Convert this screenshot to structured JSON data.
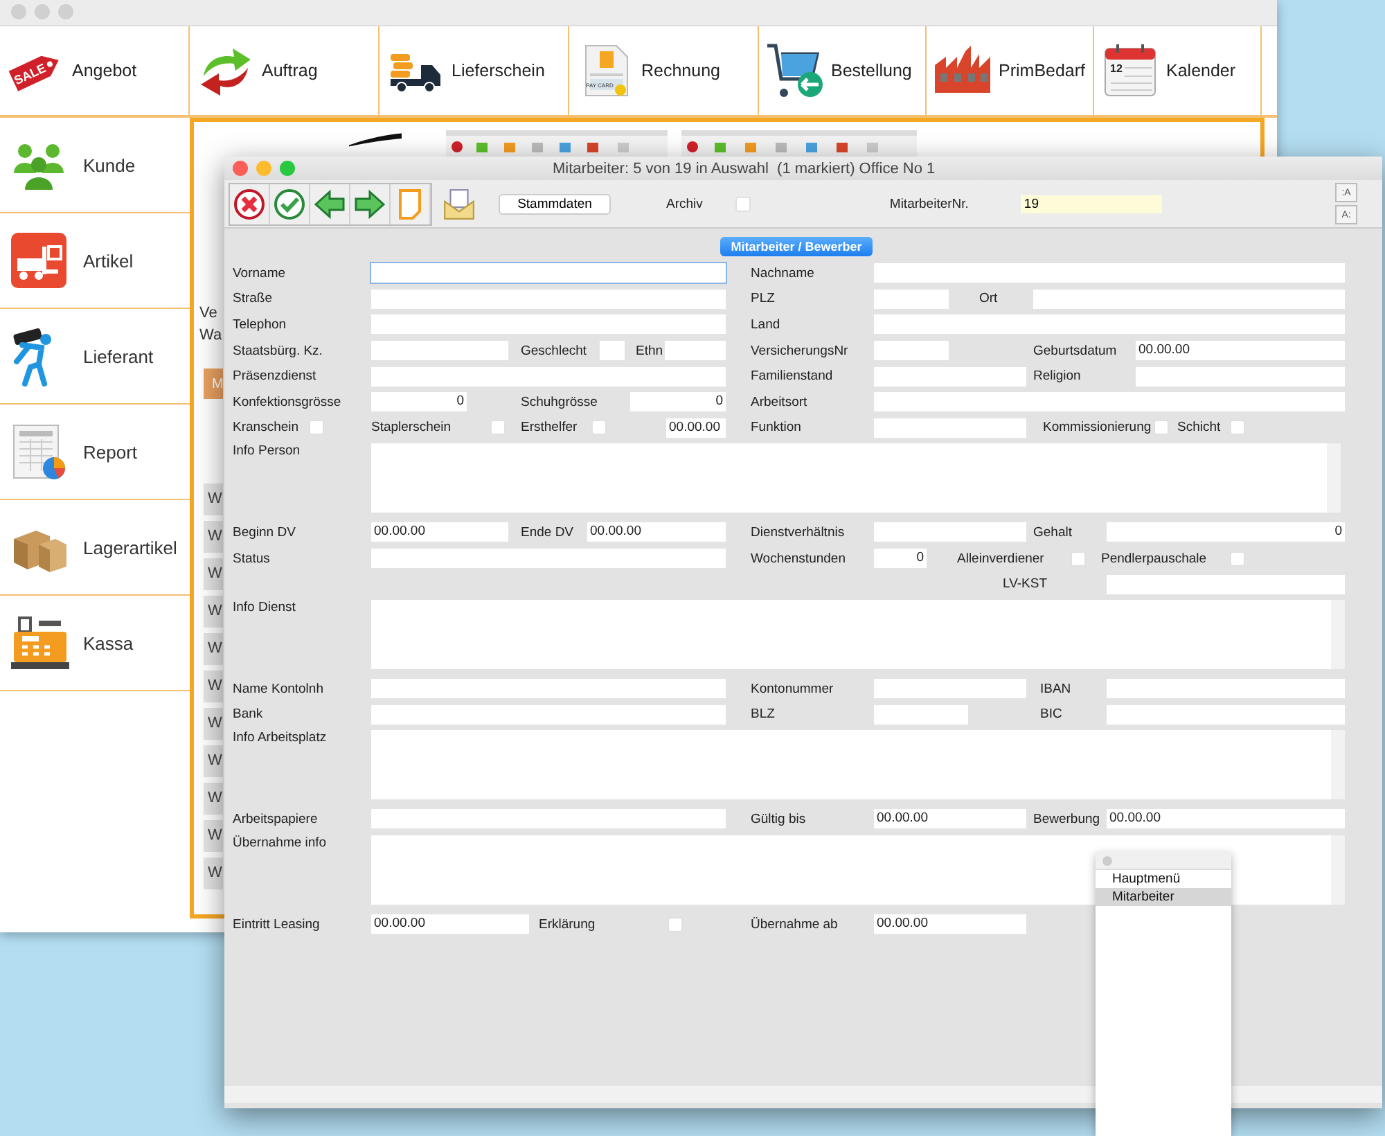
{
  "back_window": {
    "toolbar": [
      {
        "label": "Angebot",
        "badge": "SALE"
      },
      {
        "label": "Auftrag"
      },
      {
        "label": "Lieferschein"
      },
      {
        "label": "Rechnung",
        "badge": "PAY CARD"
      },
      {
        "label": "Bestellung"
      },
      {
        "label": "PrimBedarf"
      },
      {
        "label": "Kalender",
        "badge": "12"
      }
    ],
    "sidebar": [
      {
        "label": "Kunde"
      },
      {
        "label": "Artikel"
      },
      {
        "label": "Lieferant"
      },
      {
        "label": "Report"
      },
      {
        "label": "Lagerartikel"
      },
      {
        "label": "Kassa"
      }
    ],
    "content": {
      "texts": [
        "Ve",
        "Wa"
      ],
      "button": "M",
      "list_rows": [
        "W",
        "W",
        "W",
        "W",
        "W",
        "W",
        "W",
        "W",
        "W",
        "W",
        "W"
      ]
    }
  },
  "front_window": {
    "title": "Mitarbeiter: 5 von 19 in Auswahl  (1 markiert) Office No 1",
    "toolbar": {
      "button": "Stammdaten",
      "archiv_label": "Archiv",
      "archiv_checked": false,
      "nr_label": "MitarbeiterNr.",
      "nr_value": "19",
      "font_buttons": [
        ":A",
        "A:"
      ]
    },
    "tab": {
      "label": "Mitarbeiter / Bewerber",
      "selected": true
    },
    "form": [
      {
        "items": [
          {
            "kind": "label",
            "text": "Vorname"
          },
          {
            "kind": "field",
            "focused": true
          },
          {
            "kind": "label",
            "text": "Nachname"
          },
          {
            "kind": "field",
            "focused": false
          }
        ]
      },
      {
        "items": [
          {
            "kind": "label",
            "text": "Straße"
          },
          {
            "kind": "field",
            "focused": false
          },
          {
            "kind": "label",
            "text": "PLZ"
          },
          {
            "kind": "field",
            "focused": false
          },
          {
            "kind": "label",
            "text": "Ort"
          },
          {
            "kind": "field",
            "focused": false
          }
        ]
      },
      {
        "items": [
          {
            "kind": "label",
            "text": "Telephon"
          },
          {
            "kind": "field",
            "focused": false
          },
          {
            "kind": "label",
            "text": "Land"
          },
          {
            "kind": "field",
            "focused": false
          }
        ]
      },
      {
        "items": [
          {
            "kind": "label",
            "text": "Staatsbürg. Kz."
          },
          {
            "kind": "field",
            "focused": false
          },
          {
            "kind": "label",
            "text": "Geschlecht"
          },
          {
            "kind": "field",
            "focused": false
          },
          {
            "kind": "label",
            "text": "Ethn"
          },
          {
            "kind": "field",
            "focused": false
          },
          {
            "kind": "label",
            "text": "VersicherungsNr"
          },
          {
            "kind": "field",
            "focused": false
          },
          {
            "kind": "label",
            "text": "Geburtsdatum"
          },
          {
            "kind": "field",
            "value": "00.00.00",
            "focused": false
          }
        ]
      },
      {
        "items": [
          {
            "kind": "label",
            "text": "Präsenzdienst"
          },
          {
            "kind": "field",
            "focused": false
          },
          {
            "kind": "label",
            "text": "Familienstand"
          },
          {
            "kind": "field",
            "focused": false
          },
          {
            "kind": "label",
            "text": "Religion"
          },
          {
            "kind": "field",
            "focused": false
          }
        ]
      },
      {
        "items": [
          {
            "kind": "label",
            "text": "Konfektionsgrösse"
          },
          {
            "kind": "number",
            "value": "0",
            "focused": false
          },
          {
            "kind": "label",
            "text": "Schuhgrösse"
          },
          {
            "kind": "number",
            "value": "0",
            "focused": false
          },
          {
            "kind": "label",
            "text": "Arbeitsort"
          },
          {
            "kind": "field",
            "focused": false
          }
        ]
      },
      {
        "items": [
          {
            "kind": "label",
            "text": "Kranschein"
          },
          {
            "kind": "checkbox",
            "checked": false
          },
          {
            "kind": "label",
            "text": "Staplerschein"
          },
          {
            "kind": "checkbox",
            "checked": false
          },
          {
            "kind": "label",
            "text": "Ersthelfer"
          },
          {
            "kind": "checkbox",
            "checked": false
          },
          {
            "kind": "field",
            "value": "00.00.00",
            "focused": false
          },
          {
            "kind": "label",
            "text": "Funktion"
          },
          {
            "kind": "field",
            "focused": false
          },
          {
            "kind": "label",
            "text": "Kommissionierung"
          },
          {
            "kind": "checkbox",
            "checked": false
          },
          {
            "kind": "label",
            "text": "Schicht"
          },
          {
            "kind": "checkbox",
            "checked": false
          }
        ]
      },
      {
        "items": [
          {
            "kind": "label",
            "text": "Info Person"
          },
          {
            "kind": "memo"
          }
        ]
      },
      {
        "items": [
          {
            "kind": "label",
            "text": "Beginn DV"
          },
          {
            "kind": "field",
            "value": "00.00.00",
            "focused": false
          },
          {
            "kind": "label",
            "text": "Ende DV"
          },
          {
            "kind": "field",
            "value": "00.00.00",
            "focused": false
          },
          {
            "kind": "label",
            "text": "Dienstverhältnis"
          },
          {
            "kind": "field",
            "focused": false
          },
          {
            "kind": "label",
            "text": "Gehalt"
          },
          {
            "kind": "number",
            "value": "0",
            "focused": false
          }
        ]
      },
      {
        "items": [
          {
            "kind": "label",
            "text": "Status"
          },
          {
            "kind": "field",
            "focused": false
          },
          {
            "kind": "label",
            "text": "Wochenstunden"
          },
          {
            "kind": "number",
            "value": "0",
            "focused": false
          },
          {
            "kind": "label",
            "text": "Alleinverdiener"
          },
          {
            "kind": "checkbox",
            "checked": false
          },
          {
            "kind": "label",
            "text": "Pendlerpauschale"
          },
          {
            "kind": "checkbox",
            "checked": false
          }
        ]
      },
      {
        "items": [
          {
            "kind": "label",
            "text": "LV-KST"
          },
          {
            "kind": "field",
            "focused": false
          }
        ]
      },
      {
        "items": [
          {
            "kind": "label",
            "text": "Info Dienst"
          },
          {
            "kind": "memo"
          }
        ]
      },
      {
        "items": [
          {
            "kind": "label",
            "text": "Name Kontolnh"
          },
          {
            "kind": "field",
            "focused": false
          },
          {
            "kind": "label",
            "text": "Kontonummer"
          },
          {
            "kind": "field",
            "focused": false
          },
          {
            "kind": "label",
            "text": "IBAN"
          },
          {
            "kind": "field",
            "focused": false
          }
        ]
      },
      {
        "items": [
          {
            "kind": "label",
            "text": "Bank"
          },
          {
            "kind": "field",
            "focused": false
          },
          {
            "kind": "label",
            "text": "BLZ"
          },
          {
            "kind": "field",
            "focused": false
          },
          {
            "kind": "label",
            "text": "BIC"
          },
          {
            "kind": "field",
            "focused": false
          }
        ]
      },
      {
        "items": [
          {
            "kind": "label",
            "text": "Info Arbeitsplatz"
          },
          {
            "kind": "memo"
          }
        ]
      },
      {
        "items": [
          {
            "kind": "label",
            "text": "Arbeitspapiere"
          },
          {
            "kind": "field",
            "focused": false
          },
          {
            "kind": "label",
            "text": "Gültig bis"
          },
          {
            "kind": "field",
            "value": "00.00.00",
            "focused": false
          },
          {
            "kind": "label",
            "text": "Bewerbung"
          },
          {
            "kind": "field",
            "value": "00.00.00",
            "focused": false
          }
        ]
      },
      {
        "items": [
          {
            "kind": "label",
            "text": "Übernahme info"
          },
          {
            "kind": "memo"
          }
        ]
      },
      {
        "items": [
          {
            "kind": "label",
            "text": "Eintritt Leasing"
          },
          {
            "kind": "field",
            "value": "00.00.00",
            "focused": false
          },
          {
            "kind": "label",
            "text": "Erklärung"
          },
          {
            "kind": "checkbox",
            "checked": false
          },
          {
            "kind": "label",
            "text": "Übernahme ab"
          },
          {
            "kind": "field",
            "value": "00.00.00",
            "focused": false
          }
        ]
      }
    ]
  },
  "popup_menu": {
    "items": [
      {
        "label": "Hauptmenü",
        "selected": false
      },
      {
        "label": "Mitarbeiter",
        "selected": true
      }
    ]
  }
}
